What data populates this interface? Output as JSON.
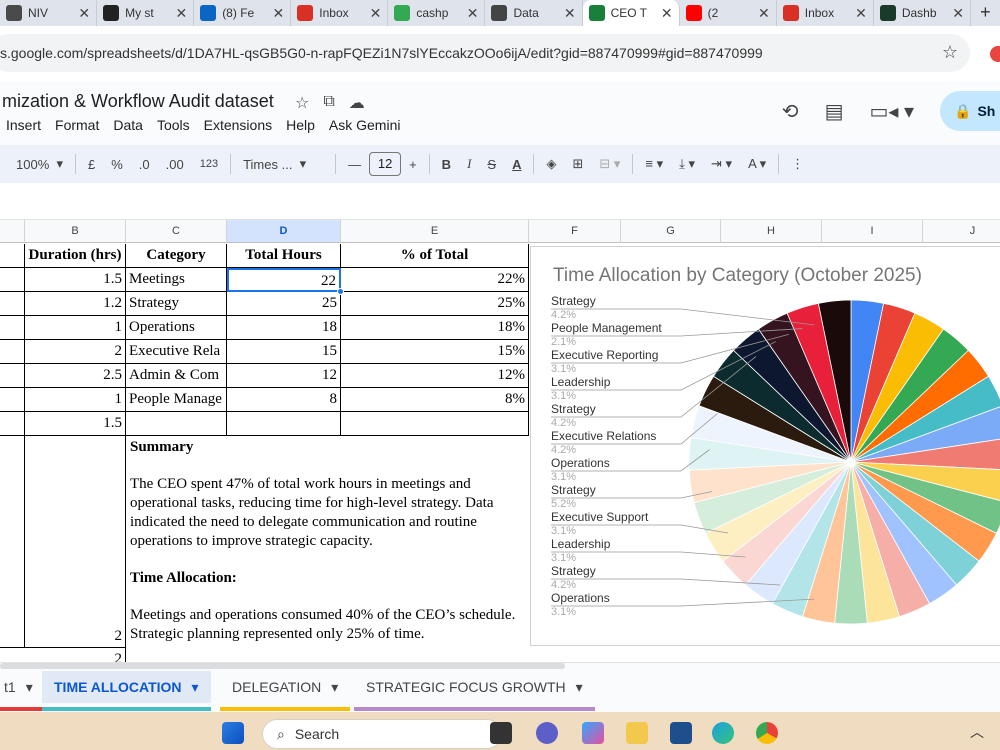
{
  "browser": {
    "tabs": [
      {
        "label": "NIV",
        "icon": "web-icon",
        "color": "#4a4a4a"
      },
      {
        "label": "My st",
        "icon": "vp-icon",
        "color": "#222222"
      },
      {
        "label": "(8) Fe",
        "icon": "linkedin-icon",
        "color": "#0a66c2"
      },
      {
        "label": "Inbox",
        "icon": "gmail-icon",
        "color": "#d93025"
      },
      {
        "label": "cashp",
        "icon": "slides-icon",
        "color": "#34a853"
      },
      {
        "label": "Data",
        "icon": "chatgpt-icon",
        "color": "#444444"
      },
      {
        "label": "CEO T",
        "icon": "sheets-icon",
        "color": "#188038",
        "active": true
      },
      {
        "label": "(2",
        "icon": "youtube-icon",
        "color": "#ff0000"
      },
      {
        "label": "Inbox",
        "icon": "gmail-icon",
        "color": "#d93025"
      },
      {
        "label": "Dashb",
        "icon": "dashboard-icon",
        "color": "#1b3b2a"
      }
    ],
    "url": "s.google.com/spreadsheets/d/1DA7HL-qsGB5G0-n-rapFQEZi1N7slYEccakzOOo6ijA/edit?gid=887470999#gid=887470999"
  },
  "doc": {
    "title": "mization & Workflow Audit dataset",
    "menu": [
      "Insert",
      "Format",
      "Data",
      "Tools",
      "Extensions",
      "Help",
      "Ask Gemini"
    ],
    "share_label": "Sh"
  },
  "toolbar": {
    "zoom": "100%",
    "currency": "£",
    "percent": "%",
    "dec_minus": ".0",
    "dec_plus": ".00",
    "numfmt": "123",
    "font": "Times ...",
    "font_size": "12"
  },
  "columns": [
    "B",
    "C",
    "D",
    "E",
    "F",
    "G",
    "H",
    "I",
    "J"
  ],
  "table": {
    "headers": [
      "Duration (hrs)",
      "Category",
      "Total Hours",
      "% of Total"
    ],
    "rows": [
      {
        "duration": "1.5",
        "category": "Meetings",
        "hours": "22",
        "pct": "22%"
      },
      {
        "duration": "1.2",
        "category": "Strategy",
        "hours": "25",
        "pct": "25%"
      },
      {
        "duration": "1",
        "category": "Operations",
        "hours": "18",
        "pct": "18%"
      },
      {
        "duration": "2",
        "category": "Executive Rela",
        "hours": "15",
        "pct": "15%"
      },
      {
        "duration": "2.5",
        "category": "Admin & Com",
        "hours": "12",
        "pct": "12%"
      },
      {
        "duration": "1",
        "category": "People Manage",
        "hours": "8",
        "pct": "8%"
      },
      {
        "duration": "1.5",
        "category": "",
        "hours": "",
        "pct": ""
      }
    ],
    "tall_row_b": "2",
    "next_row_b": "2"
  },
  "summary": {
    "heading": "Summary",
    "text": "The CEO spent 47% of total work hours in meetings and operational tasks, reducing time for high-level strategy. Data indicated the need to delegate communication and routine operations to improve strategic capacity.",
    "time_heading": "Time Allocation:",
    "time_text": "Meetings and operations consumed 40% of the CEO’s schedule. Strategic planning represented only 25% of time."
  },
  "chart_data": {
    "type": "pie",
    "title": "Time Allocation by Category (October 2025)",
    "legend_position": "left",
    "labels": [
      {
        "name": "Strategy",
        "value": "4.2%"
      },
      {
        "name": "People Management",
        "value": "2.1%"
      },
      {
        "name": "Executive Reporting",
        "value": "3.1%"
      },
      {
        "name": "Leadership",
        "value": "3.1%"
      },
      {
        "name": "Strategy",
        "value": "4.2%"
      },
      {
        "name": "Executive Relations",
        "value": "4.2%"
      },
      {
        "name": "Operations",
        "value": "3.1%"
      },
      {
        "name": "Strategy",
        "value": "5.2%"
      },
      {
        "name": "Executive Support",
        "value": "3.1%"
      },
      {
        "name": "Leadership",
        "value": "3.1%"
      },
      {
        "name": "Strategy",
        "value": "4.2%"
      },
      {
        "name": "Operations",
        "value": "3.1%"
      }
    ],
    "slice_colors": [
      "#4285f4",
      "#ea4335",
      "#fbbc04",
      "#34a853",
      "#ff6d01",
      "#46bdc6",
      "#7baaf7",
      "#f07b72",
      "#fcd04f",
      "#71c287",
      "#ff994d",
      "#7ed1d7",
      "#a0c3ff",
      "#f6aea9",
      "#fde49b",
      "#aadcb7",
      "#ffc599",
      "#b3e5e8",
      "#dbe8fd",
      "#fbd7d4",
      "#feefc3",
      "#d5eddb",
      "#ffe2cc",
      "#ddf3f4",
      "#eef4fe",
      "#2b1a0e",
      "#0b2b2e",
      "#0d1730",
      "#351420",
      "#e8203a",
      "#1a0a0a"
    ]
  },
  "sheets": {
    "tabs": [
      {
        "label": "t1",
        "underline": "#e53935"
      },
      {
        "label": "TIME ALLOCATION",
        "underline": "#46bdc6",
        "active": true
      },
      {
        "label": "DELEGATION",
        "underline": "#fbbc04"
      },
      {
        "label": "STRATEGIC FOCUS GROWTH",
        "underline": "#b48ac9"
      }
    ]
  },
  "taskbar": {
    "search_label": "Search"
  }
}
